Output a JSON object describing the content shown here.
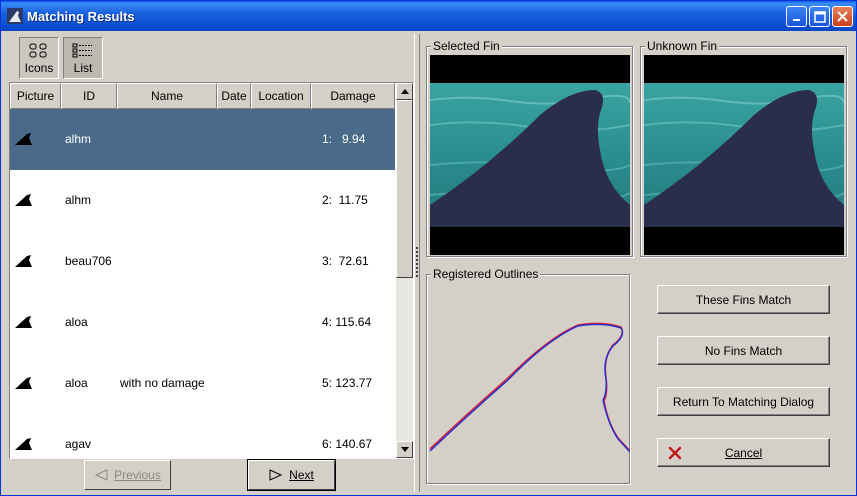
{
  "window": {
    "title": "Matching Results"
  },
  "toolbar": {
    "icons_label": "Icons",
    "list_label": "List"
  },
  "list": {
    "columns": [
      "Picture",
      "ID",
      "Name",
      "Date",
      "Location",
      "Damage"
    ],
    "rows": [
      {
        "id": "alhm",
        "name": "",
        "damage": "1:   9.94",
        "selected": true
      },
      {
        "id": "alhm",
        "name": "",
        "damage": "2:  11.75",
        "selected": false
      },
      {
        "id": "beau706",
        "name": "",
        "damage": "3:  72.61",
        "selected": false
      },
      {
        "id": "aloa",
        "name": "",
        "damage": "4: 115.64",
        "selected": false
      },
      {
        "id": "aloa",
        "name": "with no damage",
        "damage": "5: 123.77",
        "selected": false
      },
      {
        "id": "agav",
        "name": "",
        "damage": "6: 140.67",
        "selected": false
      }
    ]
  },
  "nav": {
    "previous_label": "Previous",
    "next_label": "Next"
  },
  "panels": {
    "selected_fin": "Selected Fin",
    "unknown_fin": "Unknown Fin",
    "registered_outlines": "Registered Outlines"
  },
  "actions": {
    "match_label": "These Fins Match",
    "no_match_label": "No Fins Match",
    "return_label": "Return To Matching Dialog",
    "cancel_label": "Cancel"
  },
  "colors": {
    "titlebar": "#0c4fd2",
    "selection": "#4a6a8a",
    "water": "#2a8a8c",
    "outline_red": "#d02040",
    "outline_blue": "#2030d0"
  }
}
